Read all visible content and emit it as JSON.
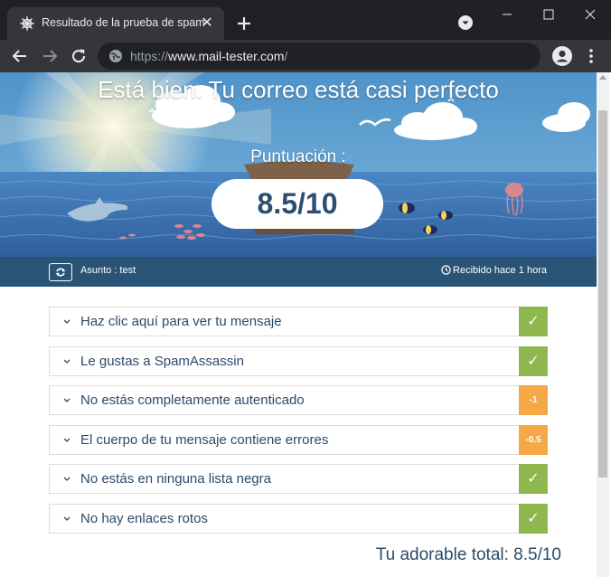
{
  "browser": {
    "tab_title": "Resultado de la prueba de spam",
    "url_prefix": "https://",
    "url_host": "www.mail-tester.com",
    "url_suffix": "/"
  },
  "hero": {
    "title": "Está bien. Tu correo está casi perfecto",
    "score_label": "Puntuación :",
    "score": "8.5/10"
  },
  "infobar": {
    "subject": "Asunto : test",
    "received": "Recibido hace 1 hora"
  },
  "checks": [
    {
      "label": "Haz clic aquí para ver tu mensaje",
      "status": "ok",
      "badge": "✓"
    },
    {
      "label": "Le gustas a SpamAssassin",
      "status": "ok",
      "badge": "✓"
    },
    {
      "label": "No estás completamente autenticado",
      "status": "warn",
      "badge": "-1"
    },
    {
      "label": "El cuerpo de tu mensaje contiene errores",
      "status": "warn",
      "badge": "-0.5"
    },
    {
      "label": "No estás en ninguna lista negra",
      "status": "ok",
      "badge": "✓"
    },
    {
      "label": "No hay enlaces rotos",
      "status": "ok",
      "badge": "✓"
    }
  ],
  "total": "Tu adorable total: 8.5/10",
  "colors": {
    "ok": "#8eb84e",
    "warn": "#f5a845",
    "score_text": "#2d4e6f",
    "infobar": "#2a5476"
  }
}
